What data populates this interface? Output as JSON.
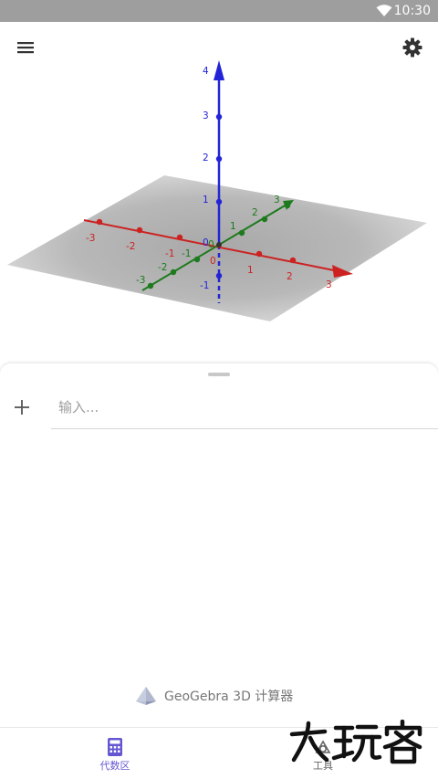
{
  "status_bar": {
    "time": "10:30"
  },
  "toolbar": {
    "menu_icon": "menu-icon",
    "settings_icon": "gear-icon"
  },
  "graphics_3d": {
    "x_axis_labels": [
      "-3",
      "-2",
      "-1",
      "0",
      "1",
      "2",
      "3"
    ],
    "y_axis_labels": [
      "-3",
      "-2",
      "-1",
      "0",
      "1",
      "2",
      "3"
    ],
    "z_axis_labels": [
      "-1",
      "0",
      "1",
      "2",
      "3",
      "4"
    ],
    "colors": {
      "x_axis": "#cc2222",
      "y_axis": "#1d7a1d",
      "z_axis": "#2323d8",
      "plane": "#b8b8b8"
    }
  },
  "algebra": {
    "input_placeholder": "输入..."
  },
  "brand": {
    "name": "GeoGebra 3D 计算器"
  },
  "bottom_nav": {
    "algebra_label": "代数区",
    "tools_label": "工具",
    "active_color": "#6557d2"
  },
  "watermark": {
    "text": "大玩客"
  }
}
